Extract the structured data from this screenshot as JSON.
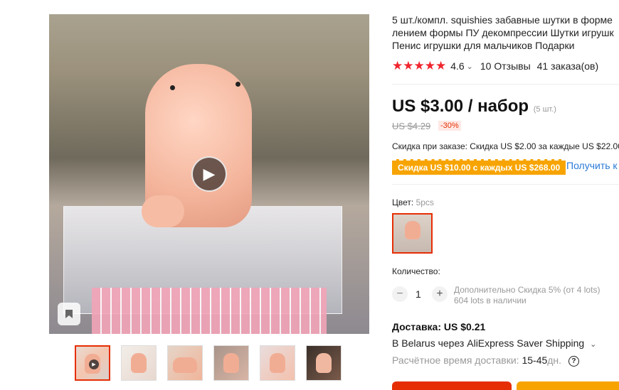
{
  "product": {
    "title_lines": [
      "5 шт./компл. squishies забавные шутки в форме",
      "лением формы ПУ декомпрессии Шутки игрушк",
      "Пенис игрушки для мальчиков Подарки"
    ],
    "stars": "★★★★★",
    "rating": "4.6",
    "reviews": "10 Отзывы",
    "orders": "41 заказа(ов)"
  },
  "price": {
    "current": "US $3.00 / набор",
    "unit": "(5 шт.)",
    "original": "US $4.29",
    "discount": "-30%"
  },
  "coupons": {
    "order_discount": "Скидка при заказе: Скидка US $2.00 за каждые US $22.00",
    "badge": "Скидка US $10.00 с каждых US $268.00",
    "get_link": "Получить к"
  },
  "color": {
    "label": "Цвет:",
    "value": "5pcs"
  },
  "quantity": {
    "label": "Количество:",
    "minus": "−",
    "value": "1",
    "plus": "+",
    "extra_discount": "Дополнительно Скидка 5% (от 4 lots)",
    "stock": "604 lots в наличии"
  },
  "shipping": {
    "title": "Доставка: US $0.21",
    "via": "В Belarus через AliExpress Saver Shipping",
    "time_label": "Расчётное время доставки:",
    "time_value": "15-45",
    "time_unit": "дн.",
    "help": "?"
  },
  "media": {
    "play_icon": "▶",
    "bookmark_icon": "🔖"
  },
  "colors": {
    "accent_red": "#e62e04",
    "star_red": "#f0252e",
    "coupon_orange": "#f7a400",
    "link_blue": "#2a7ad7"
  }
}
